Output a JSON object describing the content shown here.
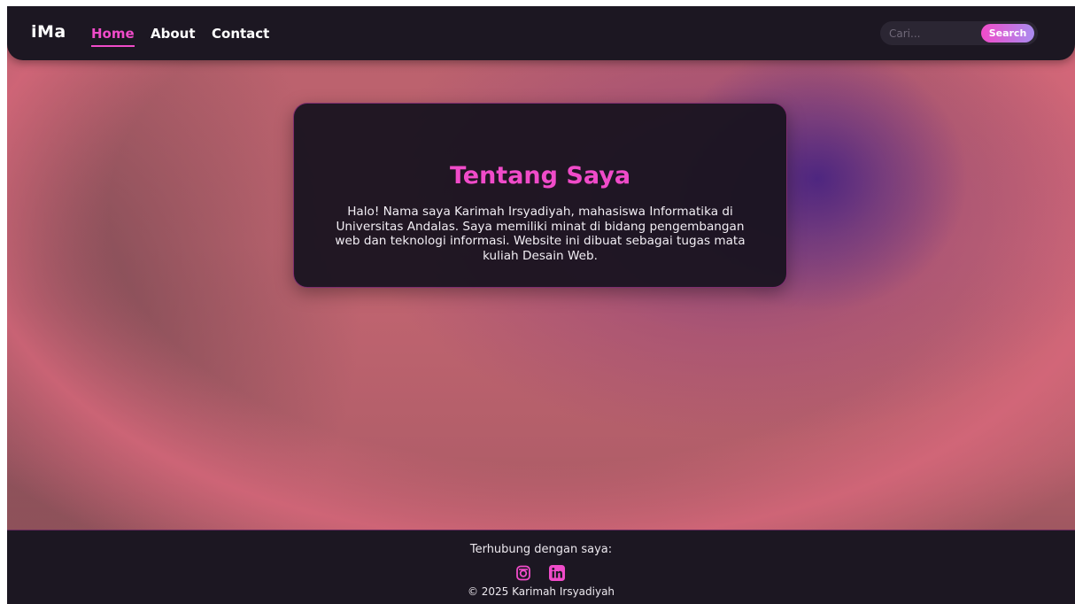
{
  "navbar": {
    "brand": "iMa",
    "links": [
      {
        "label": "Home",
        "active": true
      },
      {
        "label": "About",
        "active": false
      },
      {
        "label": "Contact",
        "active": false
      }
    ],
    "search": {
      "placeholder": "Cari...",
      "button_label": "Search"
    }
  },
  "about": {
    "title": "Tentang Saya",
    "text": "Halo! Nama saya Karimah Irsyadiyah, mahasiswa Informatika di Universitas Andalas. Saya memiliki minat di bidang pengembangan web dan teknologi informasi. Website ini dibuat sebagai tugas mata kuliah Desain Web."
  },
  "footer": {
    "connect_label": "Terhubung dengan saya:",
    "social": [
      {
        "icon": "instagram-icon"
      },
      {
        "icon": "linkedin-icon"
      }
    ],
    "copyright": "© 2025 Karimah Irsyadiyah"
  },
  "colors": {
    "accent": "#f04bc9",
    "nav_bg": "#1c1722",
    "card_bg": "#1a1420",
    "button_gradient_end": "#a98cf0"
  }
}
